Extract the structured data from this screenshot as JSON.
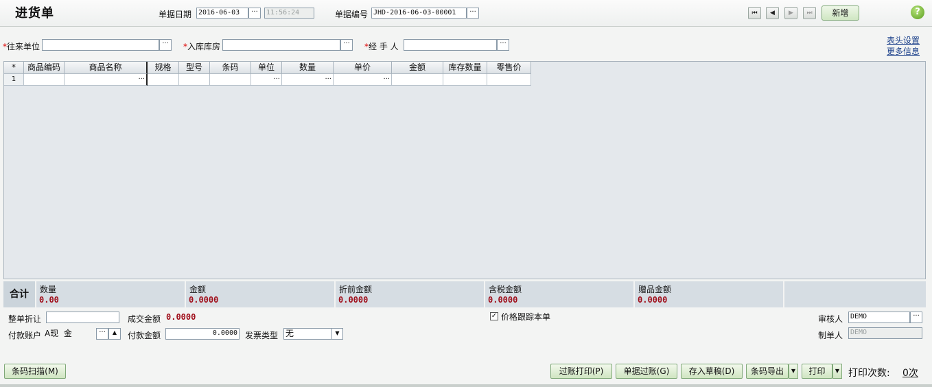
{
  "header": {
    "title": "进货单",
    "date_label": "单据日期",
    "date_value": "2016-06-03",
    "time_value": "11:56:24",
    "docno_label": "单据编号",
    "docno_value": "JHD-2016-06-03-00001",
    "new_label": "新增",
    "help": "?"
  },
  "form": {
    "partner_label": "往来单位",
    "warehouse_label": "入库库房",
    "handler_label": "经 手 人",
    "req_mark": "*",
    "header_settings_link": "表头设置",
    "more_info_link": "更多信息"
  },
  "grid": {
    "columns": [
      "*",
      "商品编码",
      "商品名称",
      "规格",
      "型号",
      "条码",
      "单位",
      "数量",
      "单价",
      "金额",
      "库存数量",
      "零售价"
    ],
    "rows": [
      {
        "num": "1"
      }
    ]
  },
  "icons": {
    "ellipsis": "···",
    "first": "⏮",
    "prev": "◀",
    "next": "▶",
    "last": "⏭",
    "dropdown": "▼",
    "up": "▲",
    "check": "✓"
  },
  "totals": {
    "sum_label": "合计",
    "qty_label": "数量",
    "qty_value": "0.00",
    "amount_label": "金额",
    "amount_value": "0.0000",
    "pre_discount_label": "折前金额",
    "pre_discount_value": "0.0000",
    "tax_label": "含税金额",
    "tax_value": "0.0000",
    "gift_label": "赠品金额",
    "gift_value": "0.0000"
  },
  "footer": {
    "discount_label": "整单折让",
    "deal_amount_label": "成交金额",
    "deal_amount_value": "0.0000",
    "price_track_label": "价格跟踪本单",
    "reviewer_label": "审核人",
    "reviewer_value": "DEMO",
    "maker_label": "制单人",
    "maker_value": "DEMO",
    "pay_account_label": "付款账户",
    "pay_account_value": "A现  金",
    "pay_amount_label": "付款金额",
    "pay_amount_value": "0.0000",
    "invoice_type_label": "发票类型",
    "invoice_type_value": "无"
  },
  "buttons": {
    "barcode_scan": "条码扫描(M)",
    "post_print": "过账打印(P)",
    "post": "单据过账(G)",
    "save_draft": "存入草稿(D)",
    "barcode_export": "条码导出",
    "print": "打印",
    "print_count_label": "打印次数:",
    "print_count_value": "0次"
  },
  "colors": {
    "accent_green": "#cfe6c2",
    "total_red": "#a0101c",
    "grid_bg": "#e4e8ec"
  }
}
